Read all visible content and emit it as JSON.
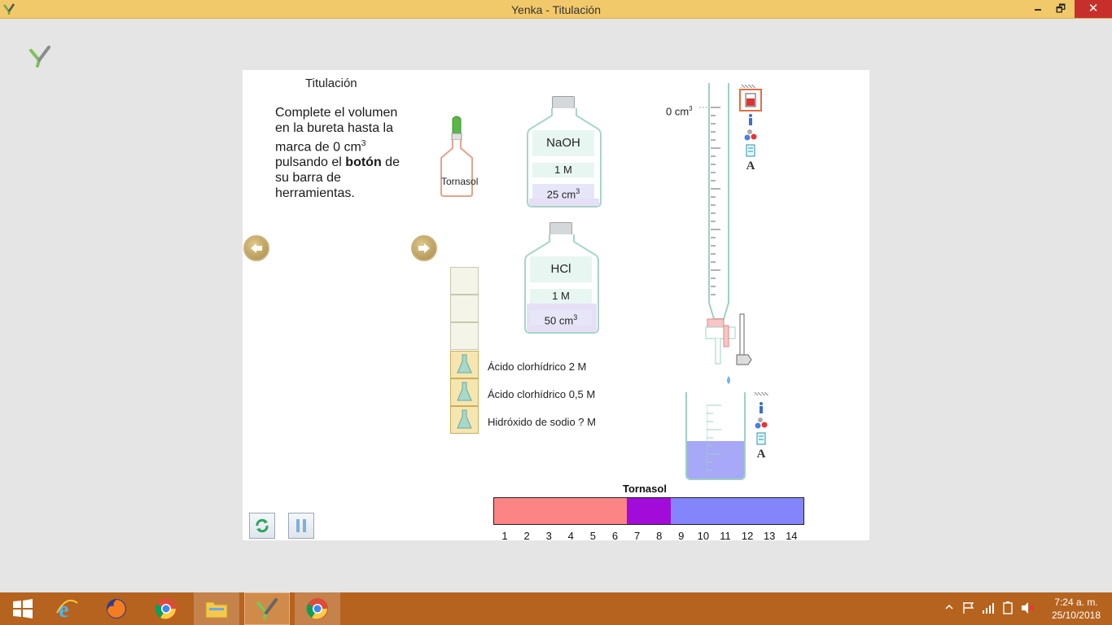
{
  "window": {
    "title": "Yenka - Titulación",
    "controls": {
      "minimize": "🗕",
      "maximize": "🗗",
      "close": "✕"
    }
  },
  "stage": {
    "title": "Titulación",
    "instructions": {
      "part1": "Complete el volumen en la bureta hasta la marca de 0 cm",
      "sup": "3",
      "part2": " pulsando el ",
      "bold": "botón",
      "part3": " de su barra de herramientas."
    },
    "tornasol_label": "Tornasol",
    "bottles": [
      {
        "name": "NaOH",
        "concentration": "1 M",
        "volume": "25 cm",
        "volume_sup": "3"
      },
      {
        "name": "HCl",
        "concentration": "1 M",
        "volume": "50 cm",
        "volume_sup": "3"
      }
    ],
    "flasks": [
      {
        "label": "Ácido clorhídrico 2 M"
      },
      {
        "label": "Ácido clorhídrico 0,5 M"
      },
      {
        "label": "Hidróxido  de sodio ? M"
      }
    ],
    "burette_zero": "0 cm",
    "burette_zero_sup": "3",
    "indicator_scale": {
      "title": "Tornasol",
      "numbers": [
        "1",
        "2",
        "3",
        "4",
        "5",
        "6",
        "7",
        "8",
        "9",
        "10",
        "11",
        "12",
        "13",
        "14"
      ],
      "colors": {
        "acid": "#fc8484",
        "neutral": "#a20cd8",
        "base": "#8585fb"
      }
    }
  },
  "taskbar": {
    "clock_time": "7:24 a. m.",
    "clock_date": "25/10/2018"
  }
}
